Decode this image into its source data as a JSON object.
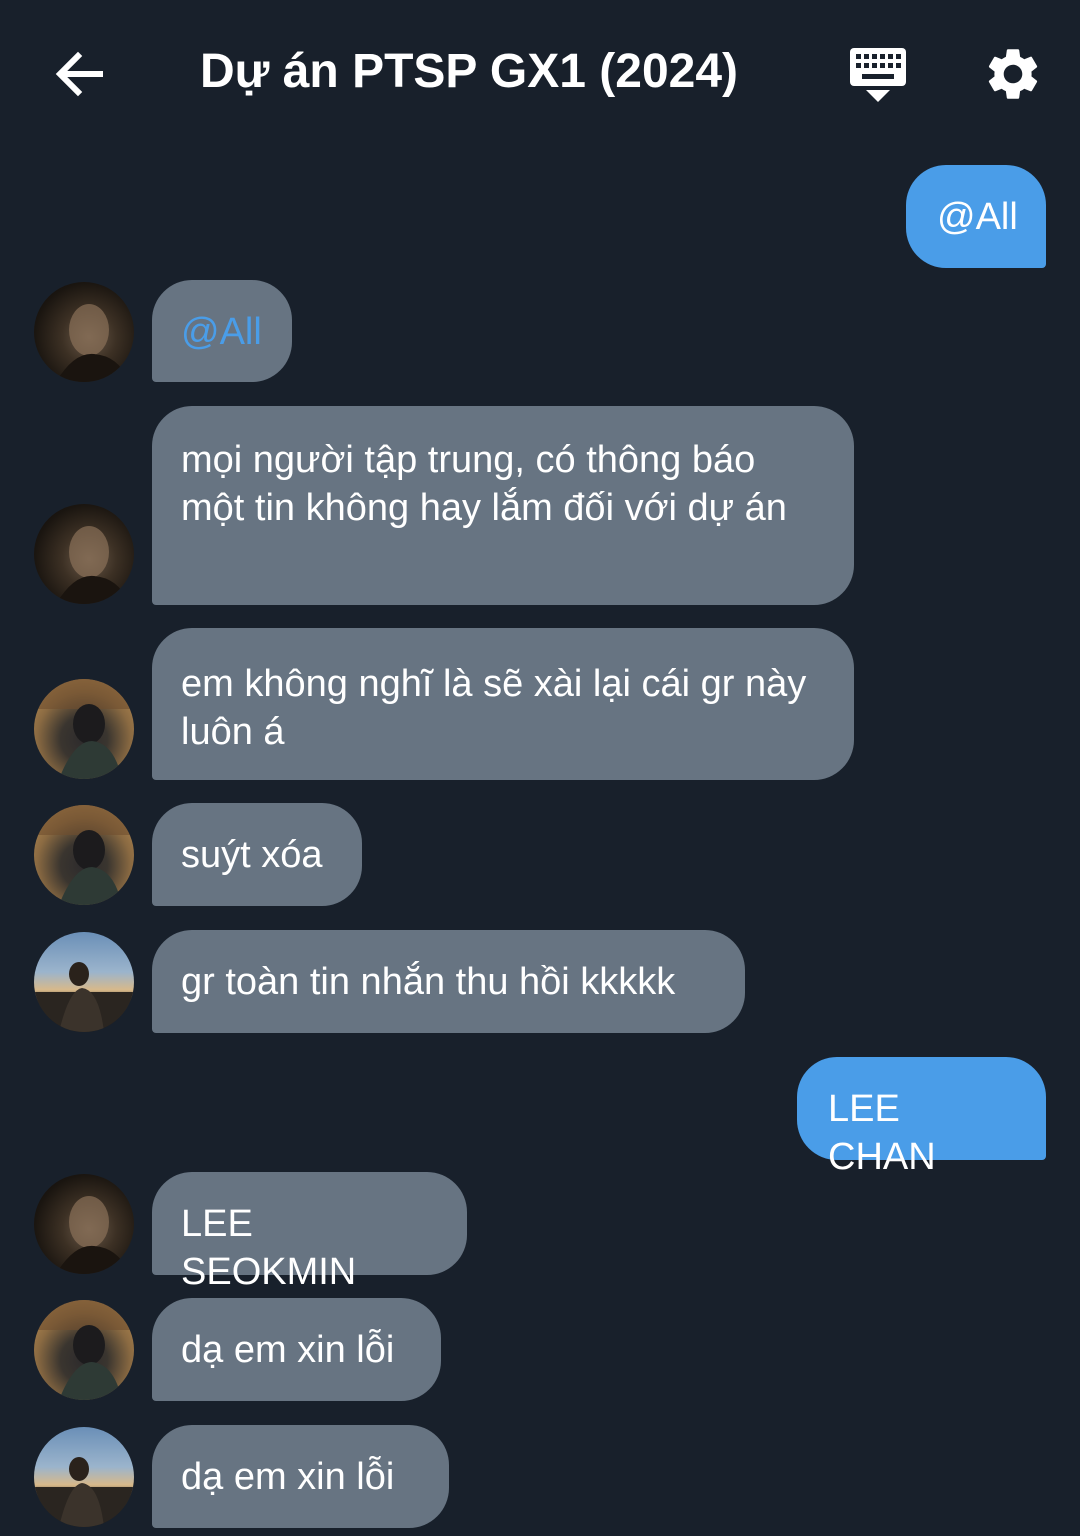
{
  "header": {
    "title": "Dự án PTSP GX1 (2024)",
    "back_icon": "arrow-left-icon",
    "keyboard_icon": "keyboard-icon",
    "settings_icon": "gear-icon"
  },
  "colors": {
    "background": "#18202b",
    "outgoing_bubble": "#4a9de8",
    "incoming_bubble": "#677482",
    "mention": "#4a9de8"
  },
  "messages": [
    {
      "direction": "out",
      "text": "@All"
    },
    {
      "direction": "in",
      "avatar": "avatar-a",
      "text": "@All",
      "mention": true
    },
    {
      "direction": "in",
      "avatar": "avatar-a",
      "text": "mọi người tập trung, có thông báo một tin không hay lắm đối với dự án"
    },
    {
      "direction": "in",
      "avatar": "avatar-b",
      "text": "em không nghĩ là sẽ xài lại cái gr này luôn á"
    },
    {
      "direction": "in",
      "avatar": "avatar-b",
      "text": "suýt xóa"
    },
    {
      "direction": "in",
      "avatar": "avatar-c",
      "text": "gr toàn tin nhắn thu hồi kkkkk"
    },
    {
      "direction": "out",
      "text": "LEE CHAN"
    },
    {
      "direction": "in",
      "avatar": "avatar-a",
      "text": "LEE SEOKMIN"
    },
    {
      "direction": "in",
      "avatar": "avatar-b",
      "text": "dạ em xin lỗi"
    },
    {
      "direction": "in",
      "avatar": "avatar-c",
      "text": "dạ em xin lỗi"
    }
  ]
}
